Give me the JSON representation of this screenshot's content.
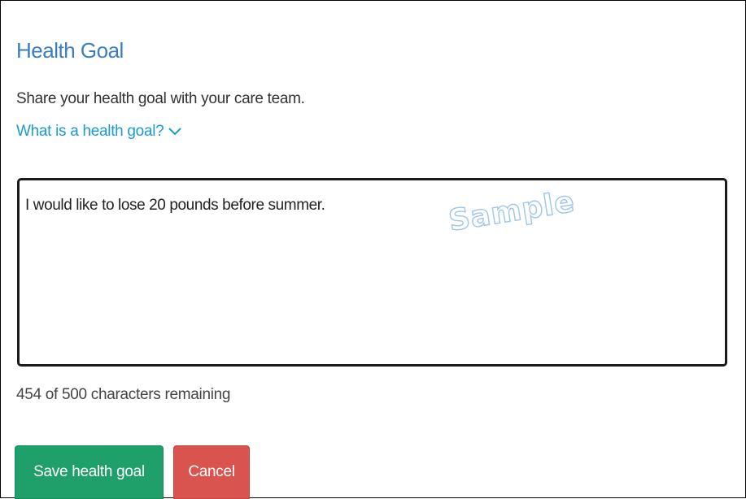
{
  "form": {
    "title": "Health Goal",
    "description": "Share your health goal with your care team.",
    "help_link": "What is a health goal?",
    "help_icon": "chevron-down-icon",
    "goal_value": "I would like to lose 20 pounds before summer.",
    "counter": "454 of 500 characters remaining",
    "watermark": "Sample"
  },
  "actions": {
    "save_label": "Save health goal",
    "cancel_label": "Cancel"
  },
  "colors": {
    "title": "#3a7dc2",
    "link": "#1a9ad6",
    "save_button": "#1f9f6a",
    "cancel_button": "#d9534f",
    "watermark_outline": "#9cc6ea"
  }
}
